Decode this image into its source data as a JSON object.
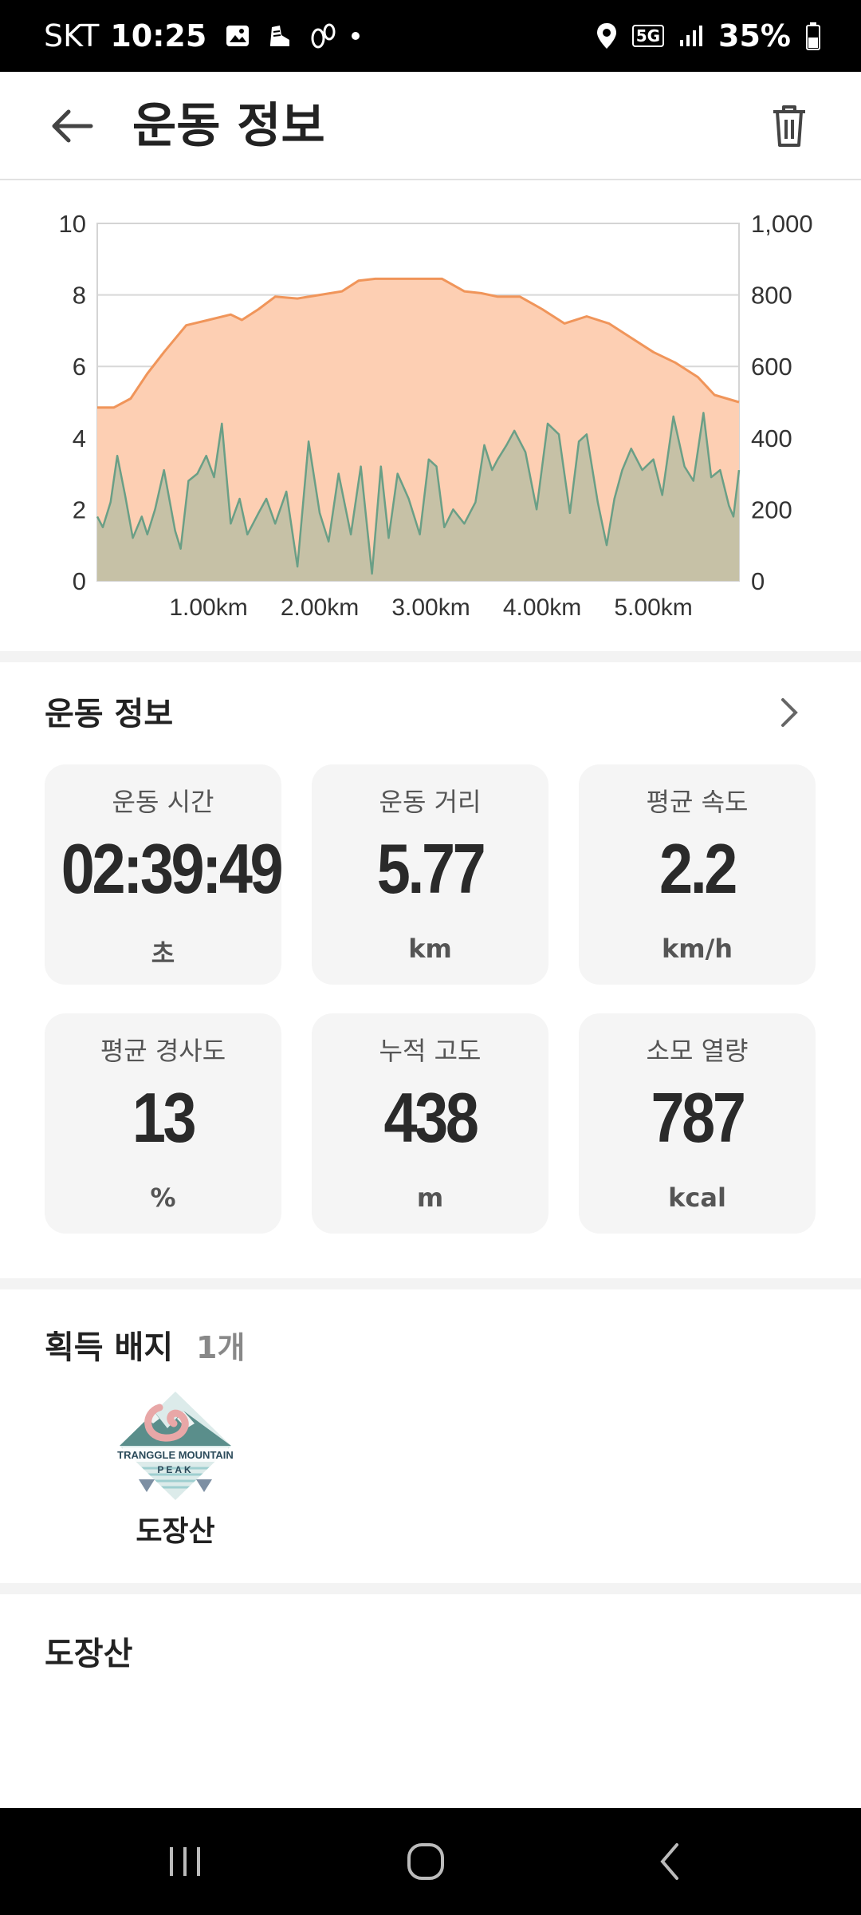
{
  "status_bar": {
    "carrier": "SKT",
    "time": "10:25",
    "network": "5G",
    "battery": "35%"
  },
  "header": {
    "title": "운동 정보"
  },
  "chart_data": {
    "type": "area",
    "x_ticks": [
      "1.00km",
      "2.00km",
      "3.00km",
      "4.00km",
      "5.00km"
    ],
    "y_left_ticks": [
      "0",
      "2",
      "4",
      "6",
      "8",
      "10"
    ],
    "y_right_ticks": [
      "0",
      "200",
      "400",
      "600",
      "800",
      "1,000"
    ],
    "ylim_left": [
      0,
      10
    ],
    "ylim_right": [
      0,
      1000
    ],
    "xlim": [
      0,
      5.77
    ],
    "grid": true,
    "series": [
      {
        "axis": "right",
        "color": "#f0955a",
        "fill": "#fdcfb3",
        "x": [
          0,
          0.15,
          0.3,
          0.45,
          0.6,
          0.8,
          1.0,
          1.2,
          1.3,
          1.45,
          1.6,
          1.8,
          2.0,
          2.2,
          2.35,
          2.5,
          2.7,
          2.9,
          3.1,
          3.3,
          3.45,
          3.6,
          3.8,
          4.0,
          4.2,
          4.4,
          4.6,
          4.8,
          5.0,
          5.2,
          5.4,
          5.55,
          5.77
        ],
        "values": [
          485,
          485,
          510,
          580,
          640,
          715,
          730,
          745,
          730,
          760,
          795,
          790,
          800,
          810,
          840,
          845,
          845,
          845,
          845,
          810,
          805,
          795,
          795,
          760,
          720,
          740,
          720,
          680,
          640,
          610,
          570,
          520,
          500
        ]
      },
      {
        "axis": "left",
        "color": "#6a9f86",
        "fill": "rgba(130,175,150,0.45)",
        "x": [
          0,
          0.05,
          0.12,
          0.18,
          0.25,
          0.32,
          0.4,
          0.45,
          0.52,
          0.6,
          0.7,
          0.75,
          0.82,
          0.9,
          0.98,
          1.05,
          1.12,
          1.2,
          1.28,
          1.35,
          1.45,
          1.52,
          1.6,
          1.7,
          1.8,
          1.9,
          2.0,
          2.08,
          2.17,
          2.28,
          2.37,
          2.47,
          2.55,
          2.62,
          2.7,
          2.8,
          2.9,
          2.98,
          3.05,
          3.12,
          3.2,
          3.3,
          3.4,
          3.48,
          3.55,
          3.6,
          3.68,
          3.75,
          3.85,
          3.95,
          4.05,
          4.15,
          4.25,
          4.33,
          4.4,
          4.5,
          4.58,
          4.65,
          4.72,
          4.8,
          4.9,
          5.0,
          5.08,
          5.18,
          5.28,
          5.36,
          5.45,
          5.52,
          5.6,
          5.68,
          5.72,
          5.77
        ],
        "values": [
          1.8,
          1.5,
          2.2,
          3.5,
          2.4,
          1.2,
          1.8,
          1.3,
          2.0,
          3.1,
          1.4,
          0.9,
          2.8,
          3.0,
          3.5,
          2.9,
          4.4,
          1.6,
          2.3,
          1.3,
          1.9,
          2.3,
          1.6,
          2.5,
          0.4,
          3.9,
          1.9,
          1.1,
          3.0,
          1.3,
          3.2,
          0.2,
          3.2,
          1.2,
          3.0,
          2.3,
          1.3,
          3.4,
          3.2,
          1.5,
          2.0,
          1.6,
          2.2,
          3.8,
          3.1,
          3.4,
          3.8,
          4.2,
          3.6,
          2.0,
          4.4,
          4.1,
          1.9,
          3.9,
          4.1,
          2.2,
          1.0,
          2.3,
          3.1,
          3.7,
          3.1,
          3.4,
          2.4,
          4.6,
          3.2,
          2.8,
          4.7,
          2.9,
          3.1,
          2.1,
          1.8,
          3.1
        ]
      }
    ]
  },
  "workout_section": {
    "title": "운동 정보"
  },
  "stats": [
    {
      "label": "운동 시간",
      "value": "02:39:49",
      "unit": "초"
    },
    {
      "label": "운동 거리",
      "value": "5.77",
      "unit": "km"
    },
    {
      "label": "평균 속도",
      "value": "2.2",
      "unit": "km/h"
    },
    {
      "label": "평균 경사도",
      "value": "13",
      "unit": "%"
    },
    {
      "label": "누적 고도",
      "value": "438",
      "unit": "m"
    },
    {
      "label": "소모 열량",
      "value": "787",
      "unit": "kcal"
    }
  ],
  "badges_section": {
    "title": "획득 배지",
    "count": "1개",
    "items": [
      {
        "name": "도장산",
        "logo_text_top": "TRANGGLE MOUNTAIN",
        "logo_text_bottom": "PEAK"
      }
    ]
  },
  "mountain_section": {
    "title": "도장산"
  },
  "colors": {
    "elevation_line": "#f0955a",
    "elevation_fill": "#fdcfb3",
    "speed_line": "#6a9f86",
    "card_bg": "#f5f5f5"
  }
}
